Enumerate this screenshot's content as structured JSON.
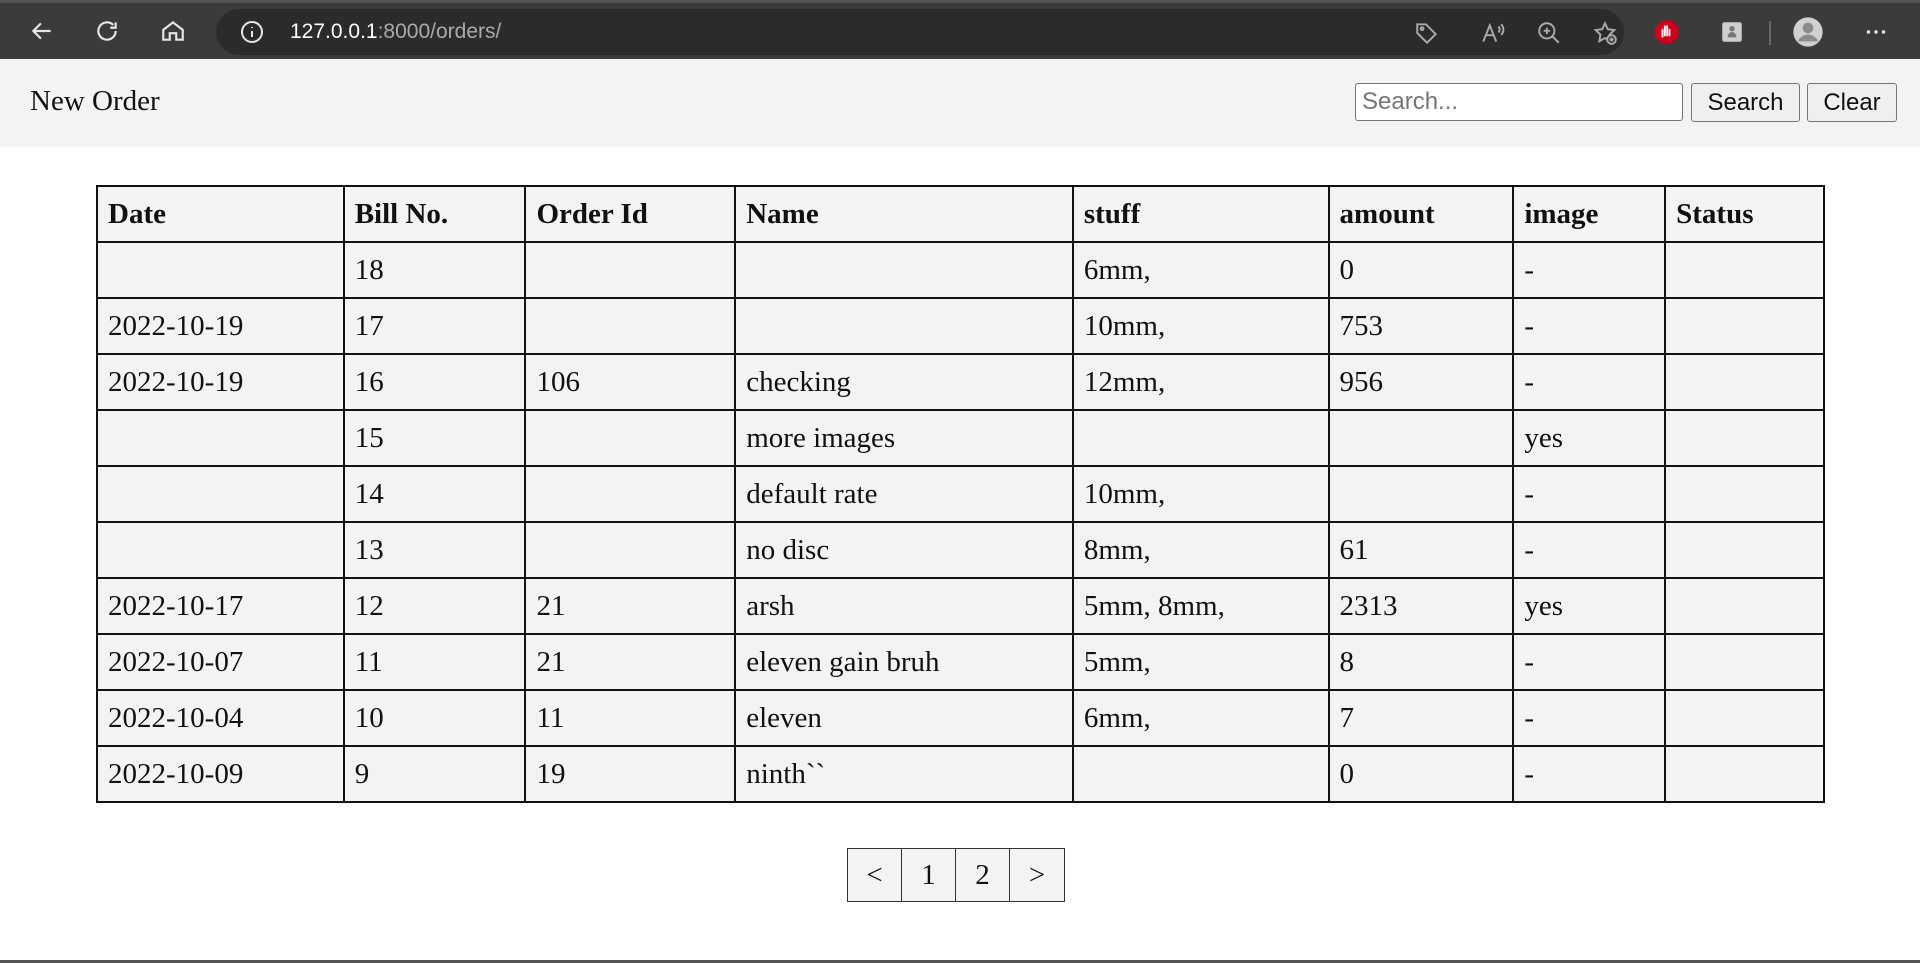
{
  "browser": {
    "url_host": "127.0.0.1",
    "url_rest": ":8000/orders/"
  },
  "header": {
    "new_order_label": "New Order",
    "search_placeholder": "Search...",
    "search_button": "Search",
    "clear_button": "Clear"
  },
  "table": {
    "columns": [
      "Date",
      "Bill No.",
      "Order Id",
      "Name",
      "stuff",
      "amount",
      "image",
      "Status"
    ],
    "rows": [
      [
        "",
        "18",
        "",
        "",
        "6mm,",
        "0",
        "-",
        ""
      ],
      [
        "2022-10-19",
        "17",
        "",
        "",
        "10mm,",
        "753",
        "-",
        ""
      ],
      [
        "2022-10-19",
        "16",
        "106",
        "checking",
        "12mm,",
        "956",
        "-",
        ""
      ],
      [
        "",
        "15",
        "",
        "more images",
        "",
        "",
        "yes",
        ""
      ],
      [
        "",
        "14",
        "",
        "default rate",
        "10mm,",
        "",
        "-",
        ""
      ],
      [
        "",
        "13",
        "",
        "no disc",
        "8mm,",
        "61",
        "-",
        ""
      ],
      [
        "2022-10-17",
        "12",
        "21",
        "arsh",
        "5mm, 8mm,",
        "2313",
        "yes",
        ""
      ],
      [
        "2022-10-07",
        "11",
        "21",
        "eleven gain bruh",
        "5mm,",
        "8",
        "-",
        ""
      ],
      [
        "2022-10-04",
        "10",
        "11",
        "eleven",
        "6mm,",
        "7",
        "-",
        ""
      ],
      [
        "2022-10-09",
        "9",
        "19",
        "ninth``",
        "",
        "0",
        "-",
        ""
      ]
    ]
  },
  "pagination": {
    "prev": "<",
    "pages": [
      "1",
      "2"
    ],
    "next": ">"
  }
}
